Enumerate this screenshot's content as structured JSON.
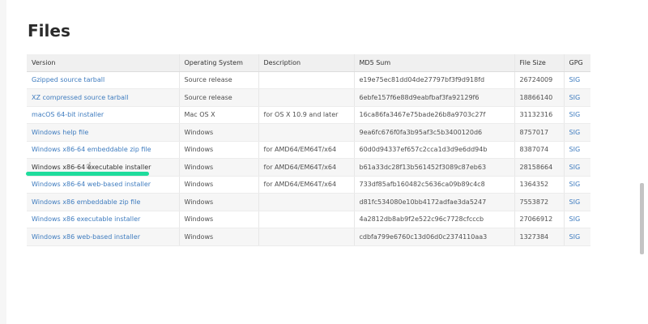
{
  "section_title": "Files",
  "columns": [
    "Version",
    "Operating System",
    "Description",
    "MD5 Sum",
    "File Size",
    "GPG"
  ],
  "rows": [
    {
      "version": "Gzipped source tarball",
      "os": "Source release",
      "description": "",
      "md5": "e19e75ec81dd04de27797bf3f9d918fd",
      "size": "26724009",
      "gpg": "SIG"
    },
    {
      "version": "XZ compressed source tarball",
      "os": "Source release",
      "description": "",
      "md5": "6ebfe157f6e88d9eabfbaf3fa92129f6",
      "size": "18866140",
      "gpg": "SIG"
    },
    {
      "version": "macOS 64-bit installer",
      "os": "Mac OS X",
      "description": "for OS X 10.9 and later",
      "md5": "16ca86fa3467e75bade26b8a9703c27f",
      "size": "31132316",
      "gpg": "SIG"
    },
    {
      "version": "Windows help file",
      "os": "Windows",
      "description": "",
      "md5": "9ea6fc676f0fa3b95af3c5b3400120d6",
      "size": "8757017",
      "gpg": "SIG"
    },
    {
      "version": "Windows x86-64 embeddable zip file",
      "os": "Windows",
      "description": "for AMD64/EM64T/x64",
      "md5": "60d0d94337ef657c2cca1d3d9e6dd94b",
      "size": "8387074",
      "gpg": "SIG"
    },
    {
      "version": "Windows x86-64 executable installer",
      "os": "Windows",
      "description": "for AMD64/EM64T/x64",
      "md5": "b61a33dc28f13b561452f3089c87eb63",
      "size": "28158664",
      "gpg": "SIG"
    },
    {
      "version": "Windows x86-64 web-based installer",
      "os": "Windows",
      "description": "for AMD64/EM64T/x64",
      "md5": "733df85afb160482c5636ca09b89c4c8",
      "size": "1364352",
      "gpg": "SIG"
    },
    {
      "version": "Windows x86 embeddable zip file",
      "os": "Windows",
      "description": "",
      "md5": "d81fc534080e10bb4172adfae3da5247",
      "size": "7553872",
      "gpg": "SIG"
    },
    {
      "version": "Windows x86 executable installer",
      "os": "Windows",
      "description": "",
      "md5": "4a2812db8ab9f2e522c96c7728cfcccb",
      "size": "27066912",
      "gpg": "SIG"
    },
    {
      "version": "Windows x86 web-based installer",
      "os": "Windows",
      "description": "",
      "md5": "cdbfa799e6760c13d06d0c2374110aa3",
      "size": "1327384",
      "gpg": "SIG"
    }
  ],
  "colors": {
    "link": "#3f7cbf",
    "highlight_mark": "#1fdc9c",
    "header_bg": "#f0f0f0",
    "stripe_bg": "#f6f6f6"
  },
  "icons": {
    "cursor": "hand-pointer-icon"
  }
}
